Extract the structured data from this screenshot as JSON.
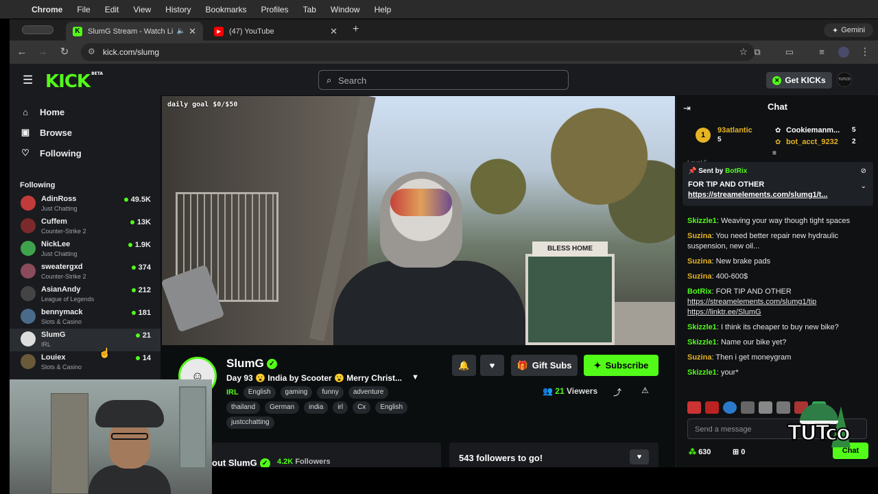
{
  "menubar": {
    "app": "Chrome",
    "items": [
      "File",
      "Edit",
      "View",
      "History",
      "Bookmarks",
      "Profiles",
      "Tab",
      "Window",
      "Help"
    ]
  },
  "browser": {
    "tabs": [
      {
        "title": "SlumG Stream - Watch Li",
        "active": true
      },
      {
        "title": "(47) YouTube",
        "active": false
      }
    ],
    "url": "kick.com/slumg",
    "gemini_label": "Gemini"
  },
  "kick": {
    "logo": "KICK",
    "logo_badge": "BETA",
    "search_placeholder": "Search",
    "get_kicks": "Get KICKs",
    "top_avatar_text": "TUTCO"
  },
  "sidebar": {
    "nav": [
      {
        "label": "Home",
        "icon": "home-icon"
      },
      {
        "label": "Browse",
        "icon": "browse-icon"
      },
      {
        "label": "Following",
        "icon": "heart-icon"
      }
    ],
    "following_heading": "Following",
    "following": [
      {
        "name": "AdinRoss",
        "category": "Just Chatting",
        "viewers": "49.5K",
        "color": "#c23b3b"
      },
      {
        "name": "Cuffem",
        "category": "Counter-Strike 2",
        "viewers": "13K",
        "color": "#7a2a2a"
      },
      {
        "name": "NickLee",
        "category": "Just Chatting",
        "viewers": "1.9K",
        "color": "#3fa34d"
      },
      {
        "name": "sweatergxd",
        "category": "Counter-Strike 2",
        "viewers": "374",
        "color": "#8a4b5a"
      },
      {
        "name": "AsianAndy",
        "category": "League of Legends",
        "viewers": "212",
        "color": "#444"
      },
      {
        "name": "bennymack",
        "category": "Slots & Casino",
        "viewers": "181",
        "color": "#4a6a8a"
      },
      {
        "name": "SlumG",
        "category": "IRL",
        "viewers": "21",
        "color": "#ddd"
      },
      {
        "name": "Louiex",
        "category": "Slots & Casino",
        "viewers": "14",
        "color": "#6a5a3a"
      }
    ]
  },
  "video": {
    "overlay_goal": "daily goal $0/$50",
    "sign_text": "BLESS HOME"
  },
  "stream": {
    "name": "SlumG",
    "title": "Day 93 😮 India by Scooter 😮 Merry Christ...",
    "category": "IRL",
    "tags_row1": [
      "English",
      "gaming",
      "funny",
      "adventure"
    ],
    "tags_row2": [
      "thailand",
      "German",
      "india",
      "irl",
      "Cx",
      "English"
    ],
    "tags_row3": [
      "justcchatting"
    ],
    "gift_label": "Gift Subs",
    "subscribe_label": "Subscribe",
    "viewers_count": "21",
    "viewers_label": "Viewers",
    "about_title": "out SlumG",
    "followers_count": "4.2K",
    "followers_label": "Followers",
    "goal_text": "543 followers to go!"
  },
  "chat": {
    "title": "Chat",
    "leaders": [
      {
        "name": "93atlantic",
        "count": "5",
        "color": "#e6b423"
      },
      {
        "name": "Cookiemanm...",
        "count": "5",
        "color": "#ffffff"
      },
      {
        "name": "bot_acct_9232",
        "count": "2",
        "color": "#e6b423"
      }
    ],
    "leader_rank": "1",
    "level_text": "Level 5",
    "pinned": {
      "sent_by": "Sent by",
      "bot": "BotRix",
      "line1": "FOR TIP AND OTHER",
      "line2": "https://streamelements.com/slumg1/t..."
    },
    "messages": [
      {
        "user": "Skizzle1",
        "color": "#53fc18",
        "text": "Weaving your way though tight spaces"
      },
      {
        "user": "Suzina",
        "color": "#e6b423",
        "text": "You need better repair new hydraulic suspension, new oil..."
      },
      {
        "user": "Suzina",
        "color": "#e6b423",
        "text": "New brake pads"
      },
      {
        "user": "Suzina",
        "color": "#e6b423",
        "text": "400-600$"
      },
      {
        "user": "BotRix",
        "color": "#53fc18",
        "text": "FOR TIP AND OTHER",
        "link1": "https://streamelements.com/slumg1/tip",
        "link2": "https://linktr.ee/SlumG"
      },
      {
        "user": "Skizzle1",
        "color": "#53fc18",
        "text": "I think its cheaper to buy new bike?"
      },
      {
        "user": "Skizzle1",
        "color": "#53fc18",
        "text": "Name our bike yet?"
      },
      {
        "user": "Suzina",
        "color": "#e6b423",
        "text": "Then i get moneygram"
      },
      {
        "user": "Skizzle1",
        "color": "#53fc18",
        "text": "your*"
      }
    ],
    "input_placeholder": "Send a message",
    "points": "630",
    "gifts": "0",
    "send_label": "Chat"
  },
  "watermark": "TUTco"
}
